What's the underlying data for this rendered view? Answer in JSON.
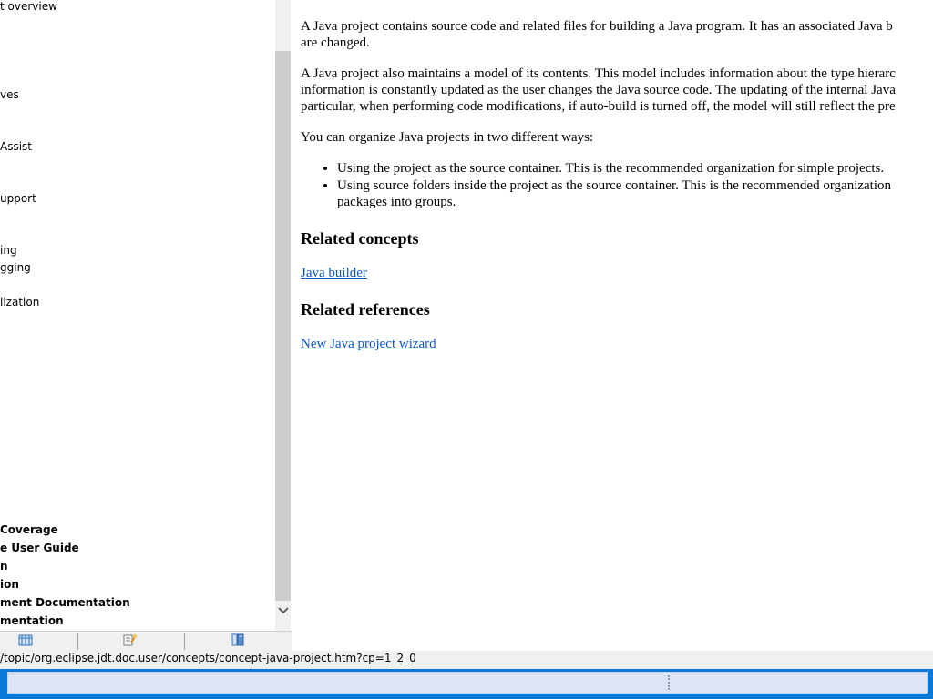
{
  "toc": {
    "items": [
      {
        "label": "t overview",
        "bold": false
      },
      {
        "label": "ves",
        "bold": false
      },
      {
        "label": " Assist",
        "bold": false
      },
      {
        "label": "upport",
        "bold": false
      },
      {
        "label": "ing",
        "bold": false
      },
      {
        "label": "gging",
        "bold": false
      },
      {
        "label": "lization",
        "bold": false
      },
      {
        "label": " Coverage",
        "bold": true
      },
      {
        "label": "e User Guide",
        "bold": true
      },
      {
        "label": "n",
        "bold": true
      },
      {
        "label": "ion",
        "bold": true
      },
      {
        "label": "ment Documentation",
        "bold": true
      },
      {
        "label": "mentation",
        "bold": true
      }
    ],
    "scroll_down_icon": "chevron-down-icon",
    "tabs": [
      {
        "icon": "contents-icon",
        "name": "tab-contents"
      },
      {
        "icon": "search-results-icon",
        "name": "tab-search-results"
      },
      {
        "icon": "bookmarks-icon",
        "name": "tab-bookmarks"
      }
    ]
  },
  "content": {
    "paragraphs": [
      "A Java project contains source code and related files for building a Java program. It has an associated Java b",
      "are changed.",
      "A Java project also maintains a model of its contents. This model includes information about the type hierarc",
      "information is constantly updated as the user changes the Java source code. The updating of the internal Java",
      "particular, when performing code modifications, if auto-build is turned off, the model will still reflect the pre",
      "You can organize Java projects in two different ways:"
    ],
    "bullets": [
      "Using the project as the source container. This is the recommended organization for simple projects.",
      "Using source folders inside the project as the source container. This is the recommended organization",
      "packages into groups."
    ],
    "related_concepts_heading": "Related concepts",
    "related_concepts_link": "Java builder",
    "related_references_heading": "Related references",
    "related_references_link": "New Java project wizard"
  },
  "status_bar": {
    "url": "/topic/org.eclipse.jdt.doc.user/concepts/concept-java-project.htm?cp=1_2_0"
  },
  "colors": {
    "link": "#0b55c4",
    "taskbar": "#0a78d7"
  }
}
